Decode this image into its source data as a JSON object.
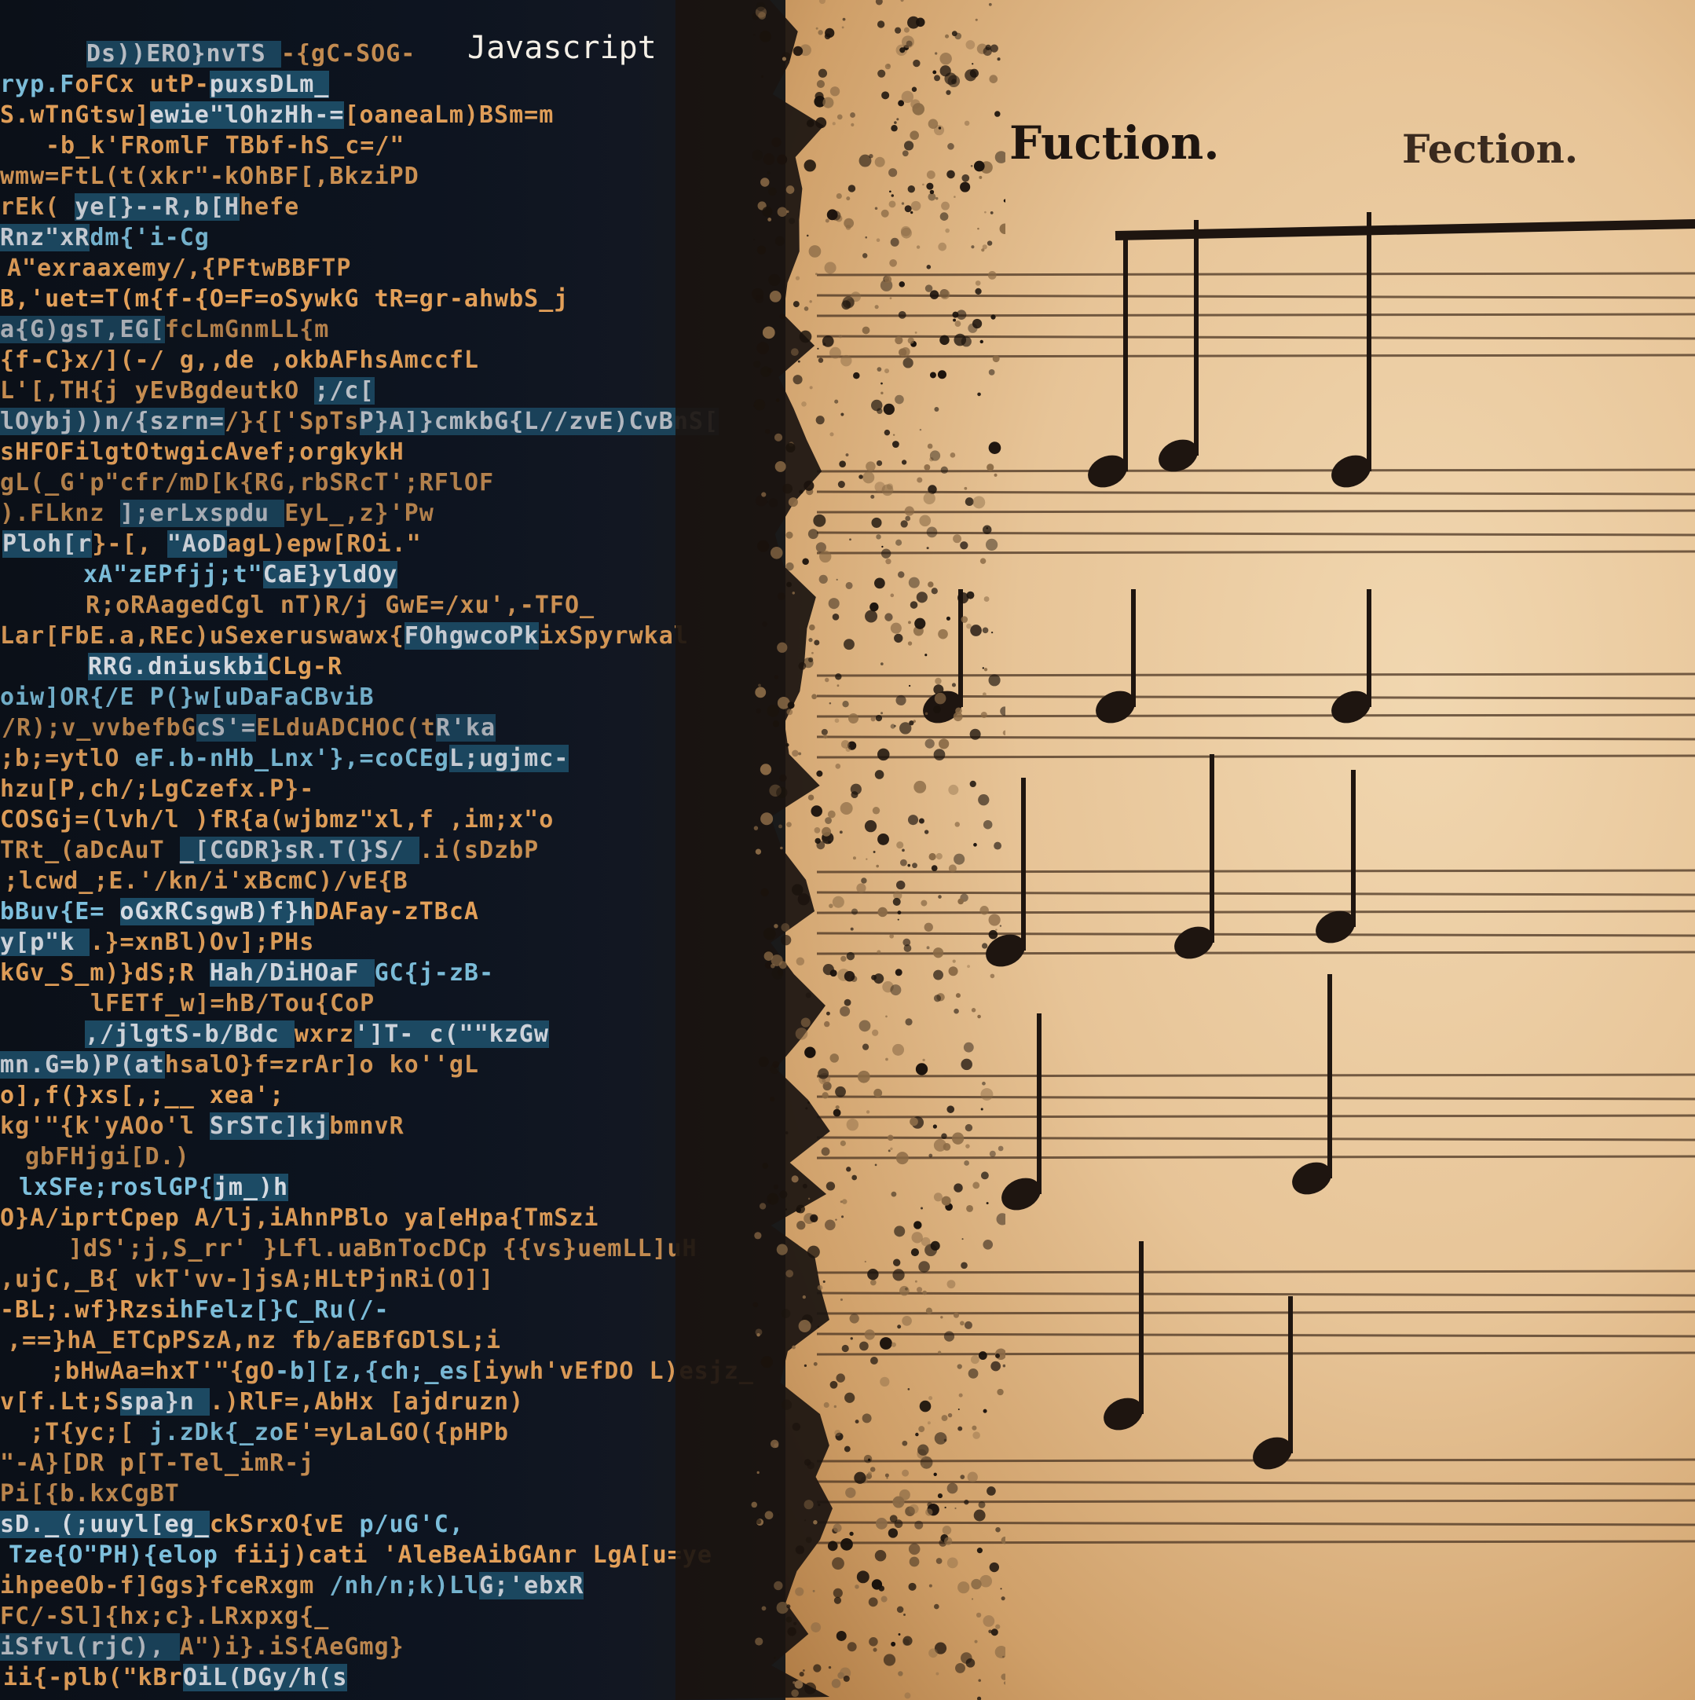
{
  "header_code": "Javascript",
  "score_titles": [
    "Fuction.",
    "Fection."
  ],
  "colors": {
    "code_background": "#0b1018",
    "code_text": "#e6a25a",
    "code_highlight": "#1d4c66",
    "parchment": "#e7c497",
    "ink": "#1e1510"
  },
  "icons": [
    "music-note-icon",
    "treble-clef-icon"
  ]
}
